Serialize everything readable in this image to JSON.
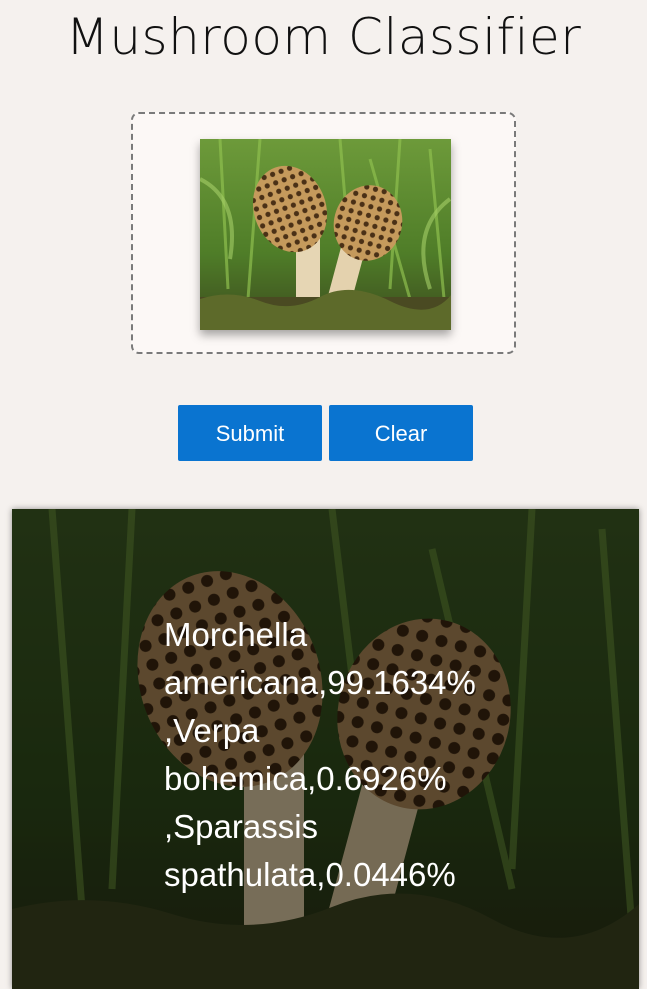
{
  "header": {
    "title": "Mushroom Classifier"
  },
  "upload": {
    "image_subject": "two morel mushrooms in grass"
  },
  "actions": {
    "submit_label": "Submit",
    "clear_label": "Clear"
  },
  "result": {
    "lines": [
      "Morchella",
      "americana,99.1634%",
      ",Verpa",
      "bohemica,0.6926%",
      ",Sparassis",
      "spathulata,0.0446%"
    ]
  },
  "colors": {
    "page_background": "#f5f1ee",
    "drop_zone_background": "#fcf8f6",
    "drop_zone_border": "#7a7a7a",
    "button_background": "#0a74d0",
    "button_text": "#ffffff",
    "result_text": "#ffffff"
  }
}
